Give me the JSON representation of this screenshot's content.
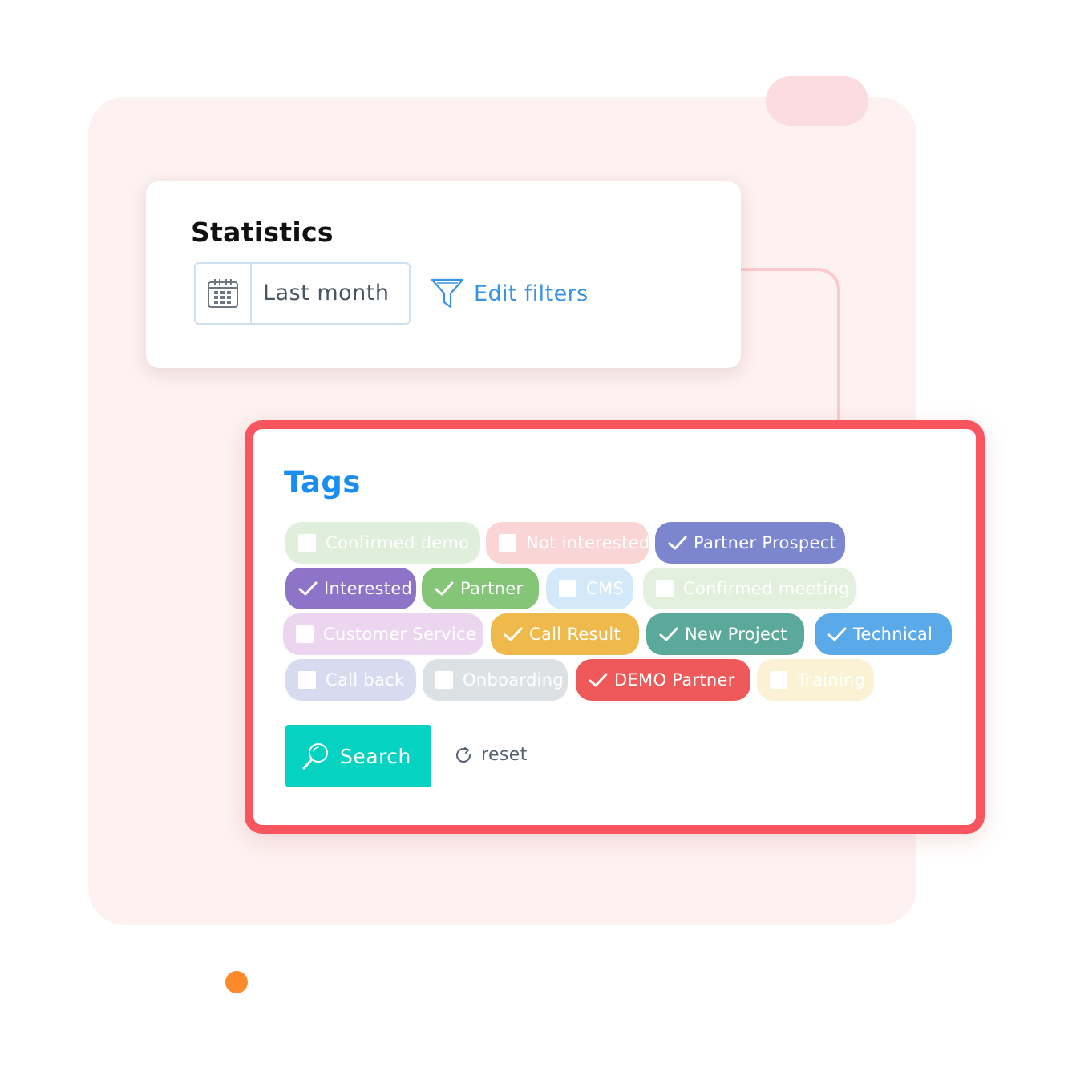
{
  "colors": {
    "accent_red": "#f8555f",
    "title_blue": "#1a8ef0",
    "link_blue": "#3a93e2",
    "search_teal": "#05d2c0",
    "background_panel": "#fdf1f1"
  },
  "statistics": {
    "title": "Statistics",
    "date_range": {
      "icon": "calendar-icon",
      "value": "Last month"
    },
    "edit_filters": {
      "icon": "filter-icon",
      "label": "Edit filters"
    }
  },
  "tags": {
    "title": "Tags",
    "items": [
      {
        "label": "Confirmed demo",
        "checked": false,
        "color": "#b9dcb0"
      },
      {
        "label": "Not interested",
        "checked": false,
        "color": "#f6a3a6"
      },
      {
        "label": "Partner Prospect",
        "checked": true,
        "color": "#7b86cf"
      },
      {
        "label": "Interested",
        "checked": true,
        "color": "#8e74c8"
      },
      {
        "label": "Partner",
        "checked": true,
        "color": "#84c578"
      },
      {
        "label": "CMS",
        "checked": false,
        "color": "#9fd0f6"
      },
      {
        "label": "Confirmed meeting",
        "checked": false,
        "color": "#c2e0b8"
      },
      {
        "label": "Customer Service",
        "checked": false,
        "color": "#d6a3dc"
      },
      {
        "label": "Call Result",
        "checked": true,
        "color": "#f0b94c"
      },
      {
        "label": "New Project",
        "checked": true,
        "color": "#5aa99a"
      },
      {
        "label": "Technical",
        "checked": true,
        "color": "#5aaaea"
      },
      {
        "label": "Call back",
        "checked": false,
        "color": "#a9b1dc"
      },
      {
        "label": "Onboarding",
        "checked": false,
        "color": "#b7bec4"
      },
      {
        "label": "DEMO Partner",
        "checked": true,
        "color": "#ef5959"
      },
      {
        "label": "Training",
        "checked": false,
        "color": "#f6e39d"
      }
    ]
  },
  "actions": {
    "search": {
      "icon": "search-icon",
      "label": "Search"
    },
    "reset": {
      "icon": "reset-icon",
      "label": "reset"
    }
  }
}
